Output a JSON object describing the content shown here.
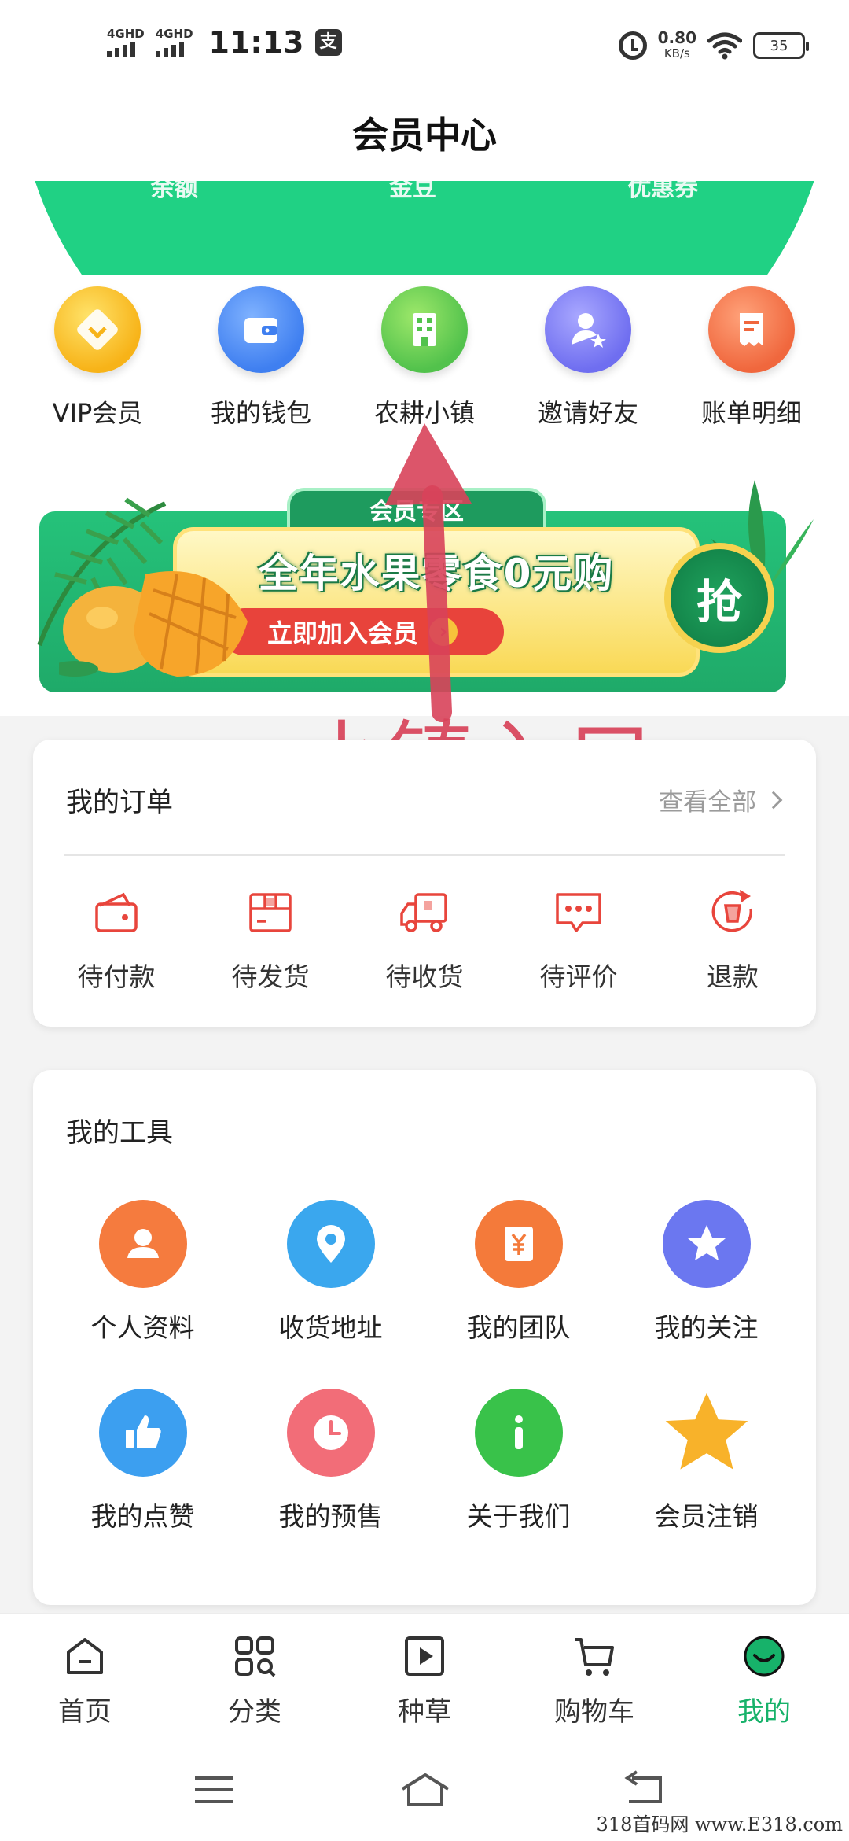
{
  "status_bar": {
    "signal1": "4GHD",
    "signal2": "4GHD",
    "time": "11:13",
    "pay_glyph": "支",
    "net_speed": "0.80",
    "net_unit": "KB/s",
    "battery": "35"
  },
  "header": {
    "title": "会员中心"
  },
  "arc_labels": [
    "余额",
    "金豆",
    "优惠券"
  ],
  "quick_links": [
    {
      "label": "VIP会员",
      "icon": "vip-diamond-icon",
      "color": "#f7b318"
    },
    {
      "label": "我的钱包",
      "icon": "wallet-icon",
      "color": "#3f7ff0"
    },
    {
      "label": "农耕小镇",
      "icon": "building-icon",
      "color": "#52c24c"
    },
    {
      "label": "邀请好友",
      "icon": "invite-user-icon",
      "color": "#6f6ef0"
    },
    {
      "label": "账单明细",
      "icon": "bill-icon",
      "color": "#f0673d"
    }
  ],
  "banner": {
    "tab": "会员专区",
    "title": "全年水果零食0元购",
    "cta": "立即加入会员",
    "grab": "抢"
  },
  "annotation": {
    "text": "小镇入口"
  },
  "orders": {
    "title": "我的订单",
    "see_all": "查看全部",
    "items": [
      {
        "label": "待付款",
        "icon": "wallet-outline-icon"
      },
      {
        "label": "待发货",
        "icon": "package-icon"
      },
      {
        "label": "待收货",
        "icon": "truck-icon"
      },
      {
        "label": "待评价",
        "icon": "comment-icon"
      },
      {
        "label": "退款",
        "icon": "refund-icon"
      }
    ]
  },
  "tools": {
    "title": "我的工具",
    "items": [
      {
        "label": "个人资料",
        "icon": "profile-icon",
        "color": "#f57b3e"
      },
      {
        "label": "收货地址",
        "icon": "location-pin-icon",
        "color": "#3aa7ee"
      },
      {
        "label": "我的团队",
        "icon": "yen-icon",
        "color": "#f47a3a"
      },
      {
        "label": "我的关注",
        "icon": "star-circle-icon",
        "color": "#6b77f0"
      },
      {
        "label": "我的点赞",
        "icon": "thumbs-up-icon",
        "color": "#3c9ff0"
      },
      {
        "label": "我的预售",
        "icon": "clock-icon",
        "color": "#f26d78"
      },
      {
        "label": "关于我们",
        "icon": "info-icon",
        "color": "#39c24a"
      },
      {
        "label": "会员注销",
        "icon": "star-icon",
        "color": "#f8b22a"
      }
    ]
  },
  "tab_bar": {
    "items": [
      {
        "label": "首页",
        "icon": "home-icon",
        "active": false
      },
      {
        "label": "分类",
        "icon": "category-icon",
        "active": false
      },
      {
        "label": "种草",
        "icon": "play-video-icon",
        "active": false
      },
      {
        "label": "购物车",
        "icon": "cart-icon",
        "active": false
      },
      {
        "label": "我的",
        "icon": "smile-face-icon",
        "active": true
      }
    ],
    "active_color": "#17b26a"
  },
  "watermark": "318首码网 www.E318.com"
}
